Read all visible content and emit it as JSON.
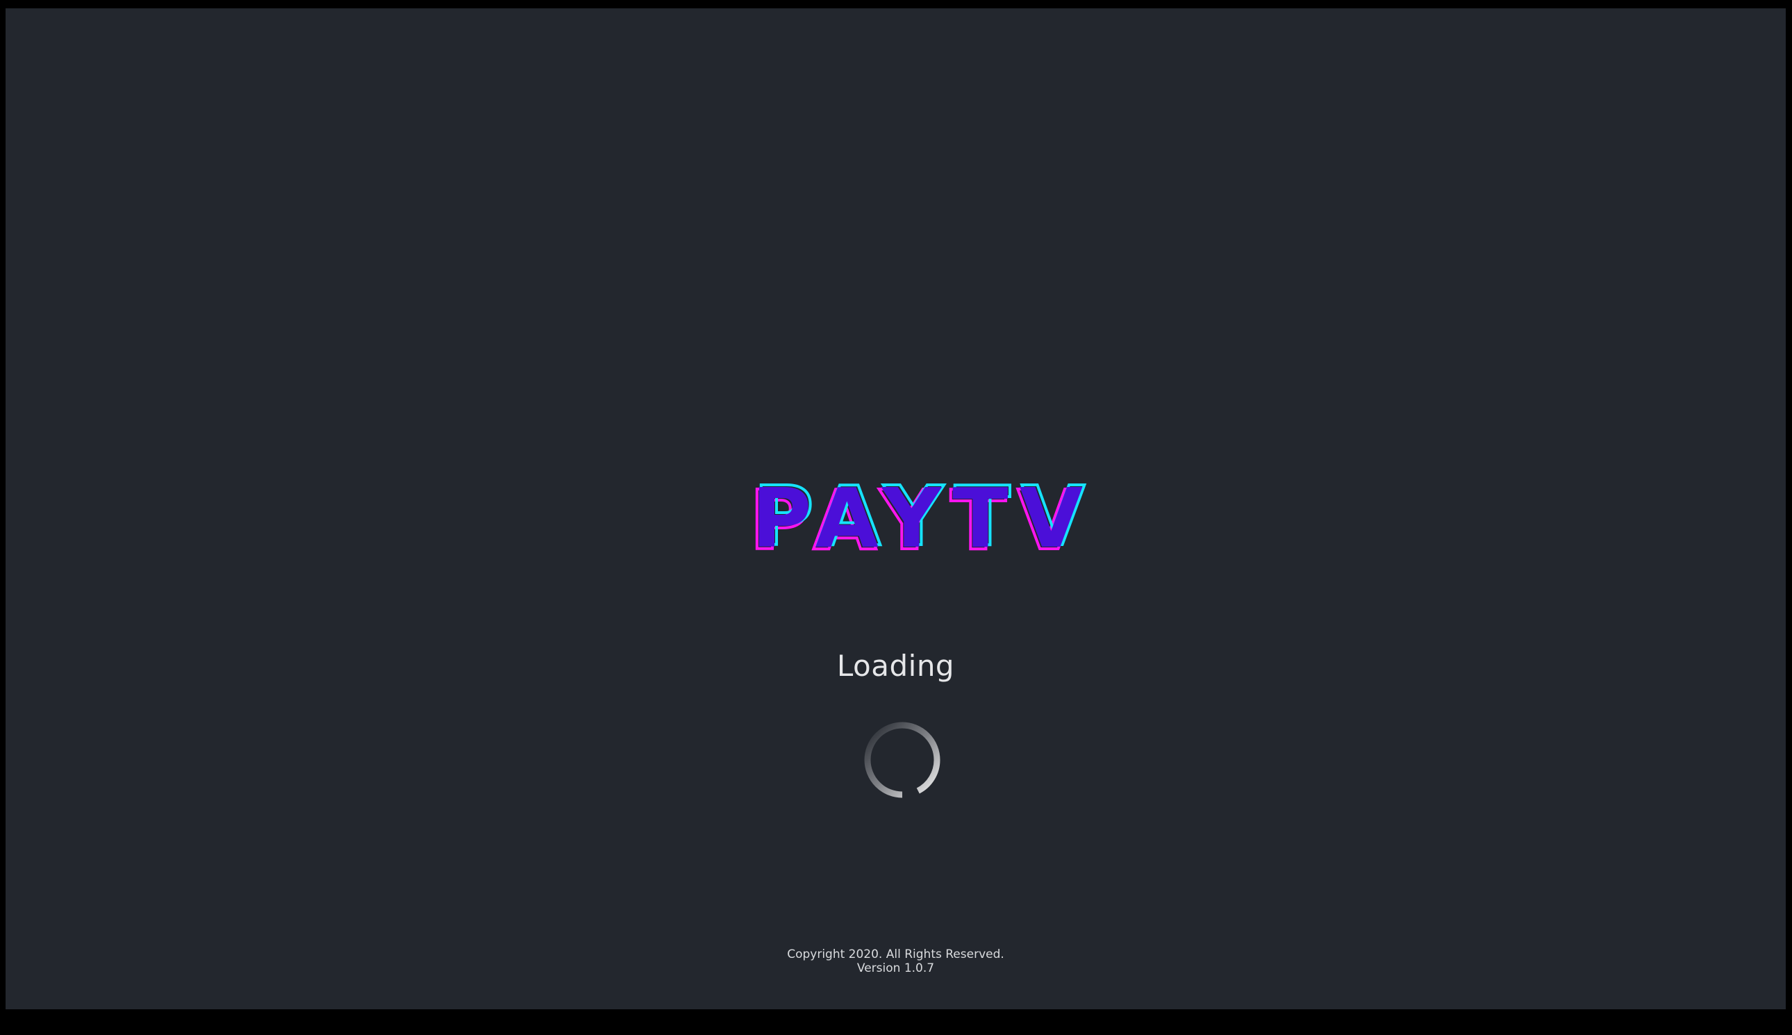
{
  "app": {
    "logo_text": "PAYTV"
  },
  "status": {
    "loading_label": "Loading",
    "spinner_icon": "loading-spinner-icon"
  },
  "footer": {
    "copyright": "Copyright 2020. All Rights Reserved.",
    "version": "Version 1.0.7"
  },
  "colors": {
    "background": "#23272e",
    "logo_fill": "#4b0fd8",
    "logo_outline_cyan": "#16e3ff",
    "logo_outline_magenta": "#ff14f0",
    "text": "#e6e7e9"
  }
}
